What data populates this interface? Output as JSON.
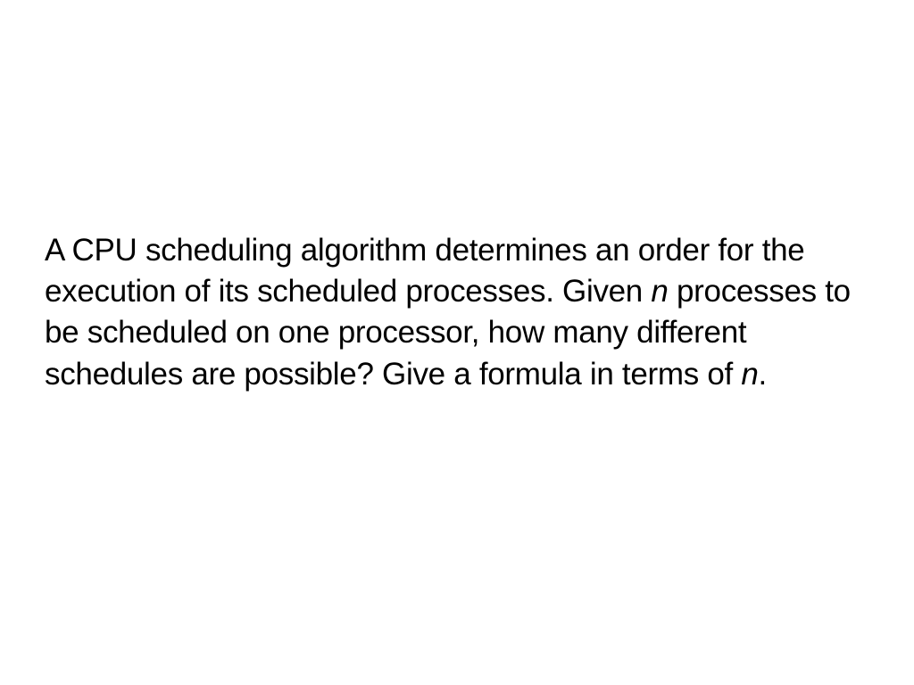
{
  "paragraph": {
    "part1": "A CPU scheduling algorithm determines an order for the execution of its scheduled processes. Given ",
    "n1": "n",
    "part2": " processes to be scheduled on one processor, how many different schedules are possible?  Give a formula in terms of ",
    "n2": "n",
    "part3": "."
  }
}
